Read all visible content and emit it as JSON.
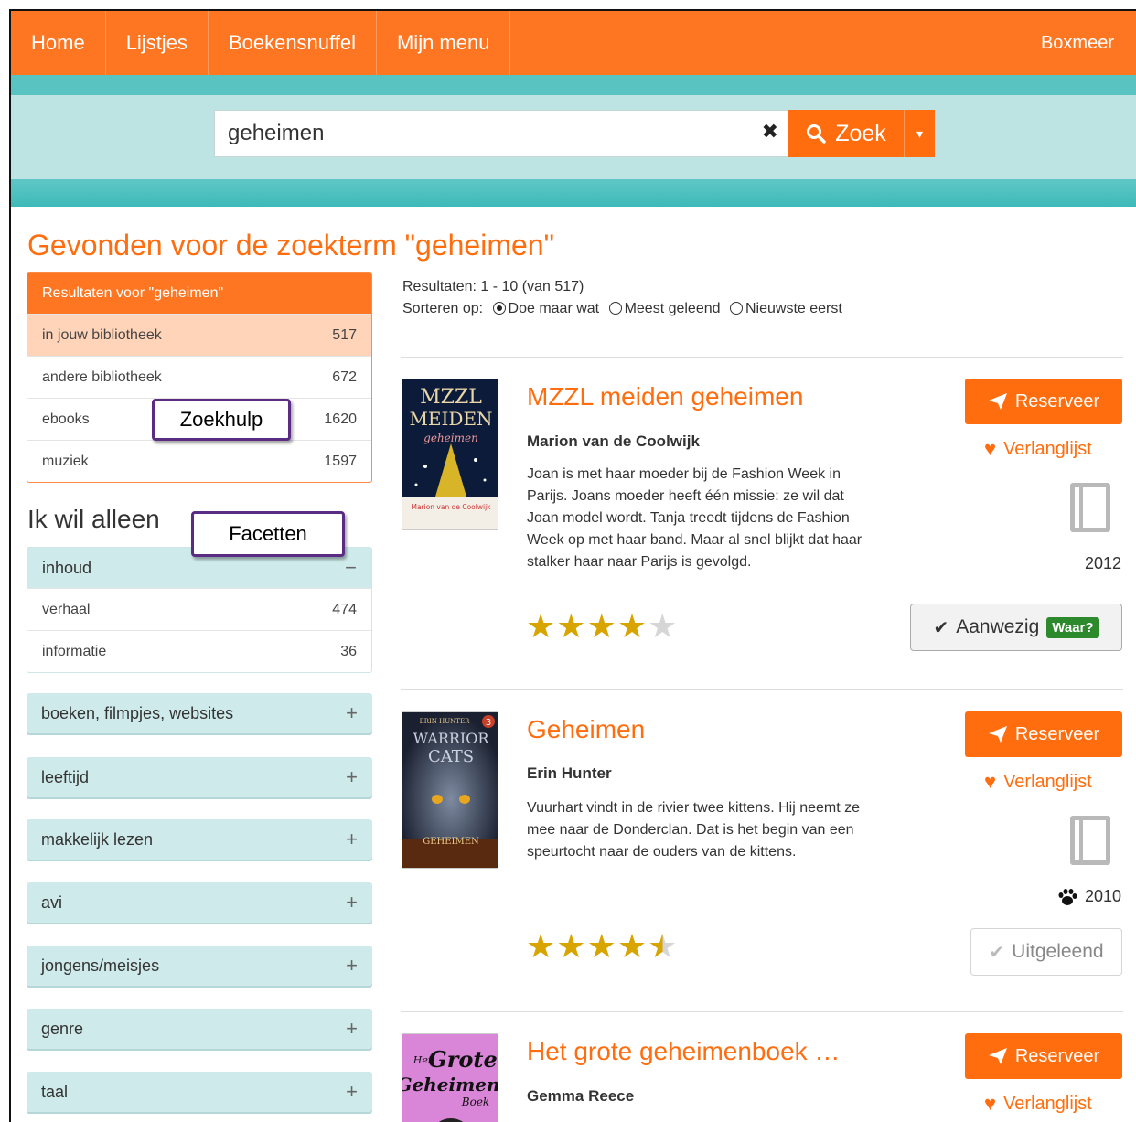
{
  "nav": {
    "items": [
      "Home",
      "Lijstjes",
      "Boekensnuffel",
      "Mijn menu"
    ],
    "location": "Boxmeer"
  },
  "search": {
    "value": "geheimen",
    "clear_glyph": "✖",
    "button_label": "Zoek",
    "dropdown_glyph": "▾"
  },
  "page": {
    "title": "Gevonden voor de zoekterm \"geheimen\""
  },
  "results_panel": {
    "header": "Resultaten voor \"geheimen\"",
    "rows": [
      {
        "label": "in jouw bibliotheek",
        "count": "517"
      },
      {
        "label": "andere bibliotheek",
        "count": "672"
      },
      {
        "label": "ebooks",
        "count": "1620"
      },
      {
        "label": "muziek",
        "count": "1597"
      }
    ]
  },
  "callouts": {
    "zoekhulp": "Zoekhulp",
    "facetten": "Facetten"
  },
  "filters": {
    "title": "Ik wil alleen",
    "open_facet": {
      "label": "inhoud",
      "sign": "−",
      "rows": [
        {
          "label": "verhaal",
          "count": "474"
        },
        {
          "label": "informatie",
          "count": "36"
        }
      ]
    },
    "collapsed": [
      {
        "label": "boeken, filmpjes, websites",
        "sign": "+"
      },
      {
        "label": "leeftijd",
        "sign": "+"
      },
      {
        "label": "makkelijk lezen",
        "sign": "+"
      },
      {
        "label": "avi",
        "sign": "+"
      },
      {
        "label": "jongens/meisjes",
        "sign": "+"
      },
      {
        "label": "genre",
        "sign": "+"
      },
      {
        "label": "taal",
        "sign": "+"
      }
    ]
  },
  "results_meta": {
    "count_text": "Resultaten: 1 - 10 (van 517)",
    "sort_label": "Sorteren op:",
    "sort_options": [
      "Doe maar wat",
      "Meest geleend",
      "Nieuwste eerst"
    ],
    "sort_selected": "Doe maar wat"
  },
  "books": [
    {
      "title": "MZZL meiden geheimen",
      "author": "Marion van de Coolwijk",
      "description": "Joan is met haar moeder bij de Fashion Week in Parijs. Joans moeder heeft één missie: ze wil dat Joan model wordt. Tanja treedt tijdens de Fashion Week op met haar band. Maar al snel blijkt dat haar stalker haar naar Parijs is gevolgd.",
      "rating": 4,
      "year": "2012",
      "reserve_label": "Reserveer",
      "wishlist_label": "Verlanglijst",
      "availability_label": "Aanwezig",
      "availability_badge": "Waar?",
      "cover": {
        "line1": "MZZL",
        "line2": "MEIDEN",
        "line3": "geheimen",
        "author": "Marion van de Coolwijk"
      }
    },
    {
      "title": "Geheimen",
      "author": "Erin Hunter",
      "description": "Vuurhart vindt in de rivier twee kittens. Hij neemt ze mee naar de Donderclan. Dat is het begin van een speurtocht naar de ouders van de kittens.",
      "rating": 4.5,
      "year": "2010",
      "reserve_label": "Reserveer",
      "wishlist_label": "Verlanglijst",
      "availability_label": "Uitgeleend",
      "cover": {
        "line1": "ERIN HUNTER",
        "line2": "WARRIOR",
        "line3": "CATS",
        "bottom": "GEHEIMEN",
        "badge": "3"
      }
    },
    {
      "title": "Het grote geheimenboek …",
      "author": "Gemma Reece",
      "reserve_label": "Reserveer",
      "wishlist_label": "Verlanglijst",
      "cover": {
        "line1": "Het",
        "line2": "Grote",
        "line3": "Geheimen",
        "line4": "Boek"
      }
    }
  ],
  "colors": {
    "brand_orange": "#ff7622",
    "teal": "#58c3c1",
    "light_teal": "#bde3e3",
    "star": "#d8a400",
    "available_green": "#2c8a2c",
    "callout_border": "#5b2c83"
  }
}
